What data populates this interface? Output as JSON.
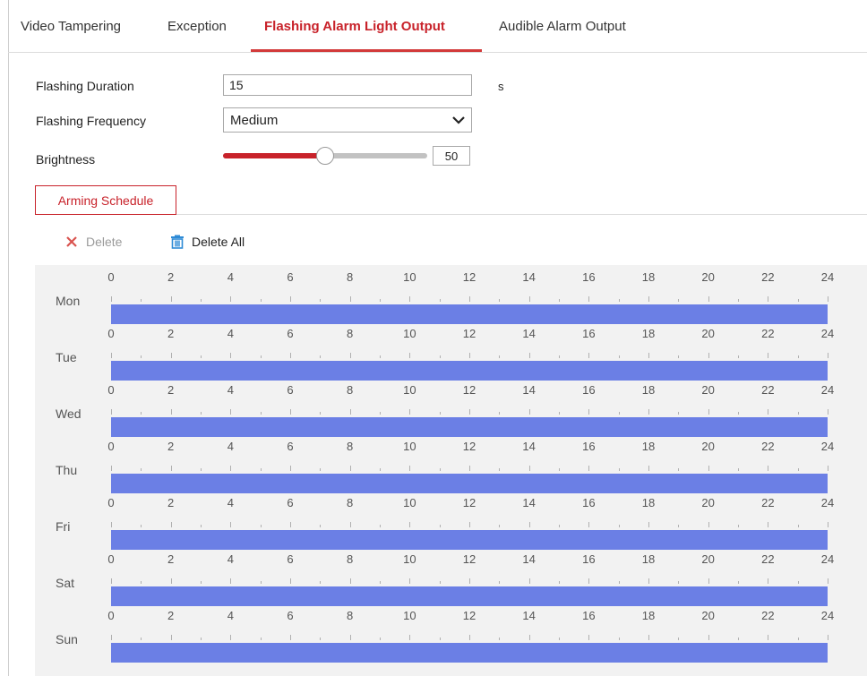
{
  "tabs": [
    {
      "label": "Video Tampering"
    },
    {
      "label": "Exception"
    },
    {
      "label": "Flashing Alarm Light Output"
    },
    {
      "label": "Audible Alarm Output"
    }
  ],
  "form": {
    "duration_label": "Flashing Duration",
    "duration_value": "15",
    "duration_unit": "s",
    "frequency_label": "Flashing Frequency",
    "frequency_value": "Medium",
    "brightness_label": "Brightness",
    "brightness_value": "50"
  },
  "arming_schedule_button": "Arming Schedule",
  "toolbar": {
    "delete_label": "Delete",
    "delete_all_label": "Delete All"
  },
  "schedule": {
    "hour_labels": [
      "0",
      "2",
      "4",
      "6",
      "8",
      "10",
      "12",
      "14",
      "16",
      "18",
      "20",
      "22",
      "24"
    ],
    "days": [
      {
        "label": "Mon",
        "start": 0,
        "end": 24
      },
      {
        "label": "Tue",
        "start": 0,
        "end": 24
      },
      {
        "label": "Wed",
        "start": 0,
        "end": 24
      },
      {
        "label": "Thu",
        "start": 0,
        "end": 24
      },
      {
        "label": "Fri",
        "start": 0,
        "end": 24
      },
      {
        "label": "Sat",
        "start": 0,
        "end": 24
      },
      {
        "label": "Sun",
        "start": 0,
        "end": 24
      }
    ]
  },
  "colors": {
    "accent": "#c8222a",
    "schedule_bar": "#6b7fe5",
    "delete_icon": "#d9534f",
    "trash_icon": "#2e8bd6"
  },
  "icons": {
    "delete": "close-icon",
    "delete_all": "trash-icon",
    "select": "chevron-down-icon"
  }
}
